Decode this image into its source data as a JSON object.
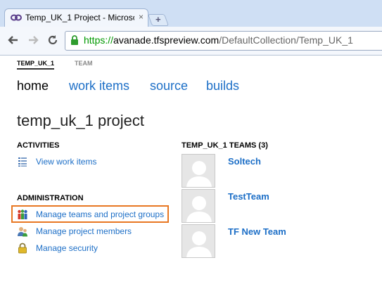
{
  "browser": {
    "tab_title": "Temp_UK_1 Project - Microsof",
    "tab_close": "×",
    "new_tab": "+",
    "url_scheme": "https://",
    "url_host": "avanade.tfspreview.com",
    "url_path": "/DefaultCollection/Temp_UK_1"
  },
  "context": {
    "active": "TEMP_UK_1",
    "inactive": "TEAM"
  },
  "nav": {
    "home": "home",
    "work_items": "work items",
    "source": "source",
    "builds": "builds"
  },
  "page_title": "temp_uk_1 project",
  "activities": {
    "heading": "ACTIVITIES",
    "view_work_items": "View work items"
  },
  "administration": {
    "heading": "ADMINISTRATION",
    "manage_teams": "Manage teams and project groups",
    "manage_members": "Manage project members",
    "manage_security": "Manage security"
  },
  "teams": {
    "heading": "TEMP_UK_1 TEAMS (3)",
    "items": [
      {
        "name": "Soltech"
      },
      {
        "name": "TestTeam"
      },
      {
        "name": "TF New Team"
      }
    ]
  },
  "colors": {
    "link": "#1d6fc7",
    "highlight": "#e87722",
    "secure": "#009900"
  }
}
